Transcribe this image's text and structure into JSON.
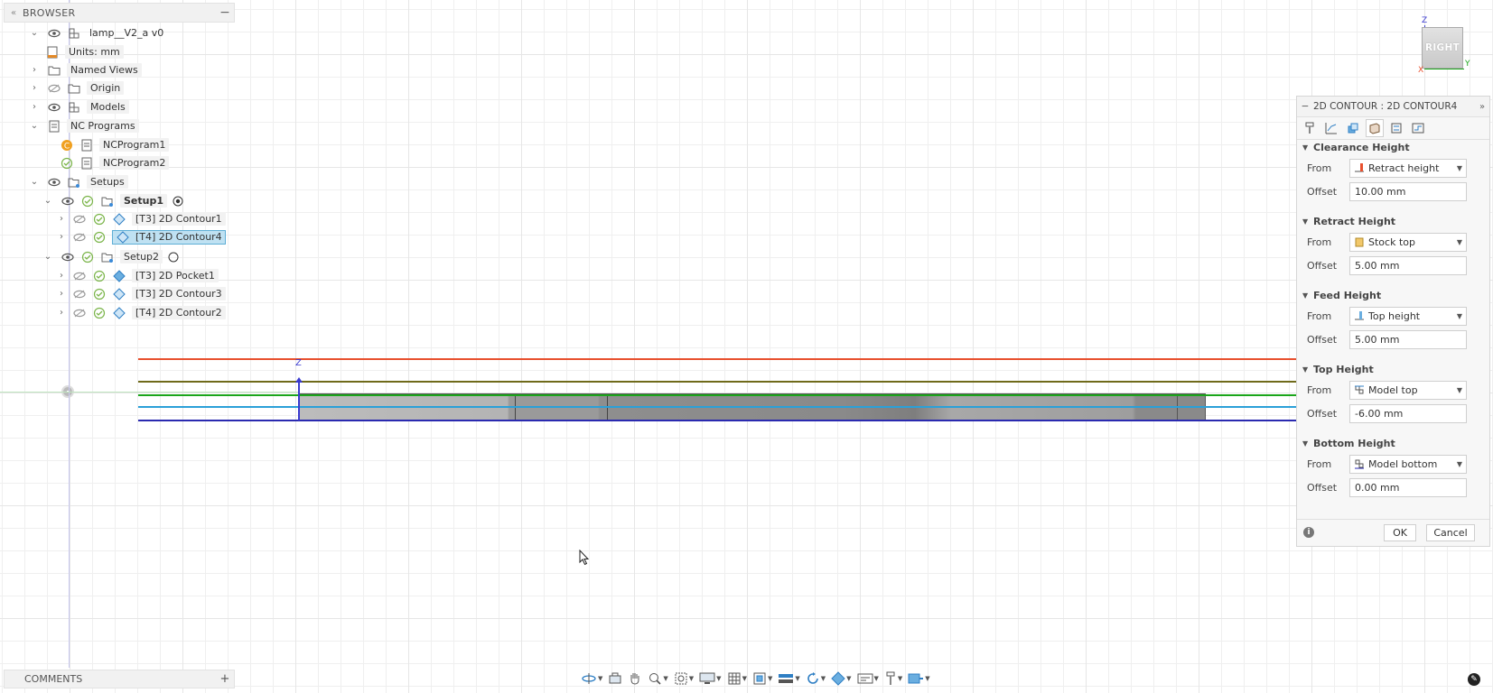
{
  "browser": {
    "title": "BROWSER",
    "collapse_icon": "double-chevron-left-icon",
    "minimize_icon": "minus-icon",
    "items": [
      {
        "label": "lamp__V2_a v0"
      },
      {
        "label": "Units: mm"
      },
      {
        "label": "Named Views"
      },
      {
        "label": "Origin"
      },
      {
        "label": "Models"
      },
      {
        "label": "NC Programs"
      },
      {
        "label": "NCProgram1"
      },
      {
        "label": "NCProgram2"
      },
      {
        "label": "Setups"
      },
      {
        "label": "Setup1"
      },
      {
        "label": "[T3] 2D Contour1"
      },
      {
        "label": "[T4] 2D Contour4"
      },
      {
        "label": "Setup2"
      },
      {
        "label": "[T3] 2D Pocket1"
      },
      {
        "label": "[T3] 2D Contour3"
      },
      {
        "label": "[T4] 2D Contour2"
      }
    ]
  },
  "viewport": {
    "axis_label": "Z",
    "height_lines": [
      {
        "name": "clearance-height",
        "color": "#e8502e"
      },
      {
        "name": "retract-height",
        "color": "#6f6a1a"
      },
      {
        "name": "feed-height",
        "color": "#1aa51a"
      },
      {
        "name": "top-height",
        "color": "#2aa0d8"
      },
      {
        "name": "bottom-height",
        "color": "#2a2ab0"
      }
    ],
    "cursor_icon": "arrow-cursor-icon"
  },
  "view_cube": {
    "face_label": "RIGHT",
    "axis_z": "Z",
    "axis_y": "Y",
    "axis_x": "X"
  },
  "panel": {
    "title": "2D CONTOUR : 2D CONTOUR4",
    "tabs": [
      "tool-icon",
      "geometry-icon",
      "heights-icon",
      "passes-icon",
      "linking-icon",
      "post-icon"
    ],
    "sections": [
      {
        "title": "Clearance Height",
        "from_label": "From",
        "from_value": "Retract height",
        "offset_label": "Offset",
        "offset_value": "10.00 mm"
      },
      {
        "title": "Retract Height",
        "from_label": "From",
        "from_value": "Stock top",
        "offset_label": "Offset",
        "offset_value": "5.00 mm"
      },
      {
        "title": "Feed Height",
        "from_label": "From",
        "from_value": "Top height",
        "offset_label": "Offset",
        "offset_value": "5.00 mm"
      },
      {
        "title": "Top Height",
        "from_label": "From",
        "from_value": "Model top",
        "offset_label": "Offset",
        "offset_value": "-6.00 mm"
      },
      {
        "title": "Bottom Height",
        "from_label": "From",
        "from_value": "Model bottom",
        "offset_label": "Offset",
        "offset_value": "0.00 mm"
      }
    ],
    "ok_label": "OK",
    "cancel_label": "Cancel"
  },
  "comments": {
    "title": "COMMENTS",
    "add_icon": "plus-icon"
  },
  "toolbar": {
    "icons": [
      "orbit-icon",
      "look-at-icon",
      "pan-icon",
      "zoom-icon",
      "fit-icon",
      "display-settings-icon",
      "grid-icon",
      "viewports-icon",
      "environment-icon",
      "simulate-icon",
      "stock-icon",
      "setup-sheet-icon",
      "tool-library-icon",
      "post-process-icon"
    ]
  }
}
